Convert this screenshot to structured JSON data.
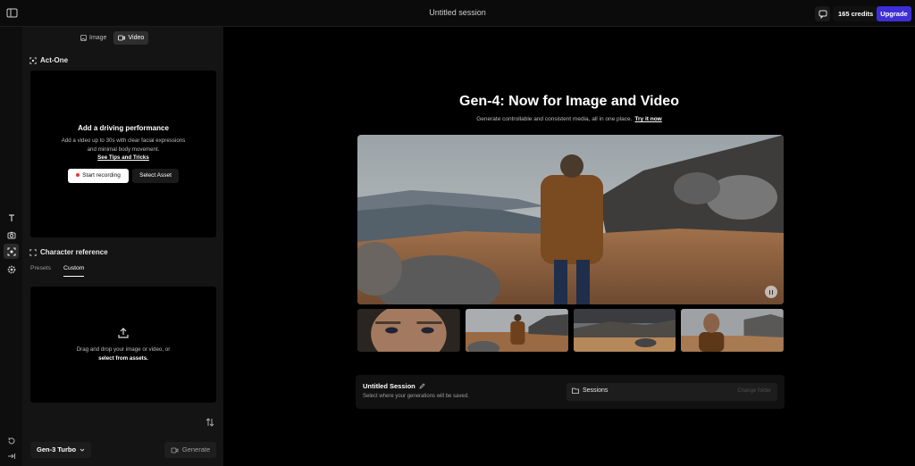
{
  "topbar": {
    "title": "Untitled session",
    "credits": "165 credits",
    "upgrade": "Upgrade"
  },
  "left": {
    "modes": [
      {
        "label": "Image"
      },
      {
        "label": "Video"
      }
    ],
    "act_one": {
      "title": "Act-One",
      "heading": "Add a driving performance",
      "desc": "Add a video up to 30s with clear facial expressions and minimal body movement.",
      "tips": "See Tips and Tricks",
      "record": "Start recording",
      "asset": "Select Asset"
    },
    "character_ref": {
      "title": "Character reference",
      "tabs": [
        "Presets",
        "Custom"
      ],
      "drop_text": "Drag and drop your image or video, or",
      "drop_link": "select from assets."
    },
    "model": "Gen-3 Turbo",
    "generate": "Generate"
  },
  "main": {
    "title": "Gen-4: Now for Image and Video",
    "subtitle": "Generate controllable and consistent media, all in one place.",
    "try_link": "Try it now",
    "session": {
      "title": "Untitled Session",
      "desc": "Select where your generations will be saved.",
      "folder": "Sessions",
      "change": "Change folder"
    }
  },
  "colors": {
    "accent": "#3d2fd6",
    "record_dot": "#e53935"
  }
}
